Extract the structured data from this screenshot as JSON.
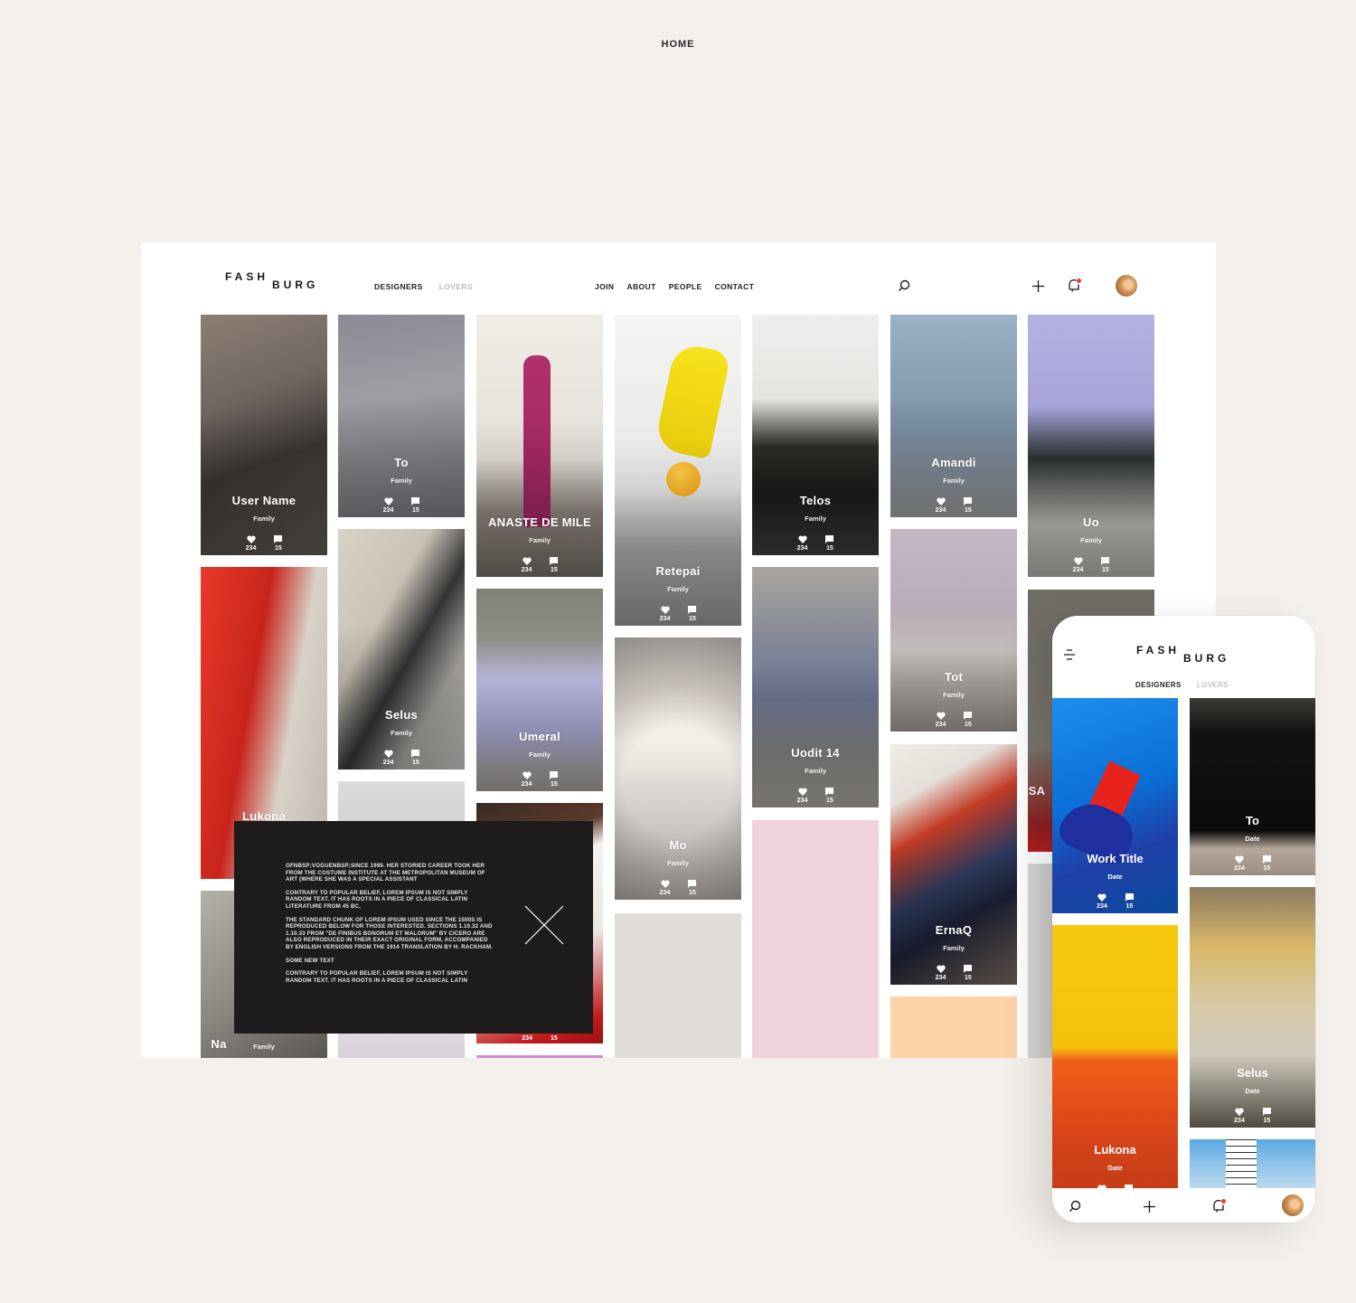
{
  "page": {
    "label": "HOME"
  },
  "brand": {
    "line1": "FASH",
    "line2": "BURG",
    "accent": "#f03b2d"
  },
  "desktop": {
    "nav_left": [
      {
        "label": "DESIGNERS",
        "active": true
      },
      {
        "label": "LOVERS",
        "active": false
      }
    ],
    "nav_right": [
      {
        "label": "JOIN"
      },
      {
        "label": "ABOUT"
      },
      {
        "label": "PEOPLE"
      },
      {
        "label": "CONTACT"
      }
    ],
    "icons": {
      "search": "search-icon",
      "add": "plus-icon",
      "notifications": "bell-icon",
      "profile": "avatar"
    },
    "cards": [
      {
        "title": "User Name",
        "sub": "Family",
        "likes": "234",
        "comments": "15"
      },
      {
        "title": "Lukona",
        "sub": "",
        "likes": "",
        "comments": ""
      },
      {
        "title": "Na",
        "sub": "Family",
        "likes": "",
        "comments": ""
      },
      {
        "title": "To",
        "sub": "Family",
        "likes": "234",
        "comments": "15"
      },
      {
        "title": "Selus",
        "sub": "Family",
        "likes": "234",
        "comments": "15"
      },
      {
        "title": "",
        "sub": "",
        "likes": "",
        "comments": ""
      },
      {
        "title": "",
        "sub": "",
        "likes": "",
        "comments": ""
      },
      {
        "title": "ANASTE DE MILE",
        "sub": "Family",
        "likes": "234",
        "comments": "15"
      },
      {
        "title": "Umeral",
        "sub": "Family",
        "likes": "234",
        "comments": "15"
      },
      {
        "title": "",
        "sub": "",
        "likes": "234",
        "comments": "15"
      },
      {
        "title": "Retepai",
        "sub": "Family",
        "likes": "234",
        "comments": "15"
      },
      {
        "title": "Mo",
        "sub": "Family",
        "likes": "234",
        "comments": "15"
      },
      {
        "title": "Telos",
        "sub": "Family",
        "likes": "234",
        "comments": "15"
      },
      {
        "title": "Uodit 14",
        "sub": "Family",
        "likes": "234",
        "comments": "15"
      },
      {
        "title": "Amandi",
        "sub": "Family",
        "likes": "234",
        "comments": "15"
      },
      {
        "title": "Tot",
        "sub": "Family",
        "likes": "234",
        "comments": "15"
      },
      {
        "title": "ErnaQ",
        "sub": "Family",
        "likes": "234",
        "comments": "15"
      },
      {
        "title": "Uo",
        "sub": "Family",
        "likes": "234",
        "comments": "15"
      },
      {
        "title": "SA",
        "sub": "",
        "likes": "",
        "comments": ""
      }
    ],
    "modal": {
      "paragraphs": [
        "OFNBSP;VOGUENBSP;SINCE 1999. HER STORIED CAREER TOOK HER FROM THE COSTUME INSTITUTE AT THE METROPOLITAN MUSEUM OF ART (WHERE SHE WAS A SPECIAL ASSISTANT",
        "CONTRARY TO POPULAR BELIEF, LOREM IPSUM IS NOT SIMPLY RANDOM TEXT. IT HAS ROOTS IN A PIECE OF CLASSICAL LATIN LITERATURE FROM 45 BC,",
        "THE STANDARD CHUNK OF LOREM IPSUM USED SINCE THE 1500S IS REPRODUCED BELOW FOR THOSE INTERESTED. SECTIONS 1.10.32 AND 1.10.33 FROM \"DE FINIBUS BONORUM ET MALORUM\" BY CICERO ARE ALSO REPRODUCED IN THEIR EXACT ORIGINAL FORM, ACCOMPANIED BY ENGLISH VERSIONS FROM THE 1914 TRANSLATION BY H. RACKHAM.",
        "SOME NEW TEXT",
        "CONTRARY TO POPULAR BELIEF, LOREM IPSUM IS NOT SIMPLY RANDOM TEXT. IT HAS ROOTS IN A PIECE OF CLASSICAL LATIN"
      ]
    }
  },
  "mobile": {
    "tabs": [
      {
        "label": "DESIGNERS",
        "active": true
      },
      {
        "label": "LOVERS",
        "active": false
      }
    ],
    "cards": [
      {
        "title": "Work Title",
        "sub": "Date",
        "likes": "234",
        "comments": "15"
      },
      {
        "title": "Lukona",
        "sub": "Date",
        "likes": "",
        "comments": ""
      },
      {
        "title": "To",
        "sub": "Date",
        "likes": "234",
        "comments": "15"
      },
      {
        "title": "Selus",
        "sub": "Date",
        "likes": "234",
        "comments": "15"
      },
      {
        "title": "",
        "sub": "",
        "likes": "",
        "comments": ""
      }
    ]
  }
}
